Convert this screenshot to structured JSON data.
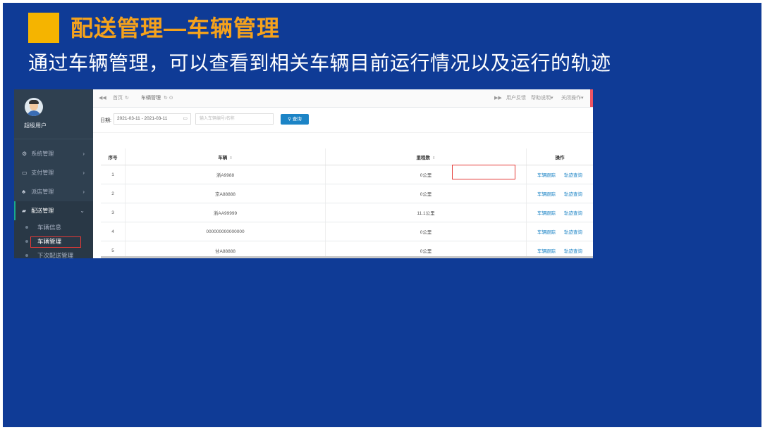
{
  "slide": {
    "title": "配送管理—车辆管理",
    "subtitle": "通过车辆管理，可以查看到相关车辆目前运行情况以及运行的轨迹"
  },
  "sidebar": {
    "username": "超级用户",
    "menu": [
      {
        "icon": "gears-icon",
        "label": "系统管理"
      },
      {
        "icon": "card-icon",
        "label": "支付管理"
      },
      {
        "icon": "sitemap-icon",
        "label": "派店管理"
      },
      {
        "icon": "truck-icon",
        "label": "配送管理"
      }
    ],
    "submenu": [
      "车辆信息",
      "车辆管理",
      "下次配送管理"
    ]
  },
  "tabs": {
    "back": "◀◀",
    "home": "首页",
    "refresh": "↻",
    "active": "车辆管理",
    "forward": "▶▶",
    "user_feedback": "用户反馈",
    "help": "帮助说明▾",
    "close_ops": "关闭操作▾"
  },
  "filter": {
    "date_label": "日期:",
    "date_value": "2021-03-11 - 2021-03-11",
    "search_placeholder": "输入车辆编号/名称",
    "search_button": "查询"
  },
  "table": {
    "headers": {
      "index": "序号",
      "vehicle": "车辆",
      "mileage": "里程数",
      "action": "操作"
    },
    "action_track": "车辆跟踪",
    "action_route": "轨迹查询",
    "rows": [
      {
        "index": "1",
        "vehicle": "浙A9988",
        "mileage": "0公里"
      },
      {
        "index": "2",
        "vehicle": "京A88888",
        "mileage": "0公里"
      },
      {
        "index": "3",
        "vehicle": "浙AA99999",
        "mileage": "11.1公里"
      },
      {
        "index": "4",
        "vehicle": "000000000000000",
        "mileage": "0公里"
      },
      {
        "index": "5",
        "vehicle": "甘A88888",
        "mileage": "0公里"
      }
    ]
  }
}
